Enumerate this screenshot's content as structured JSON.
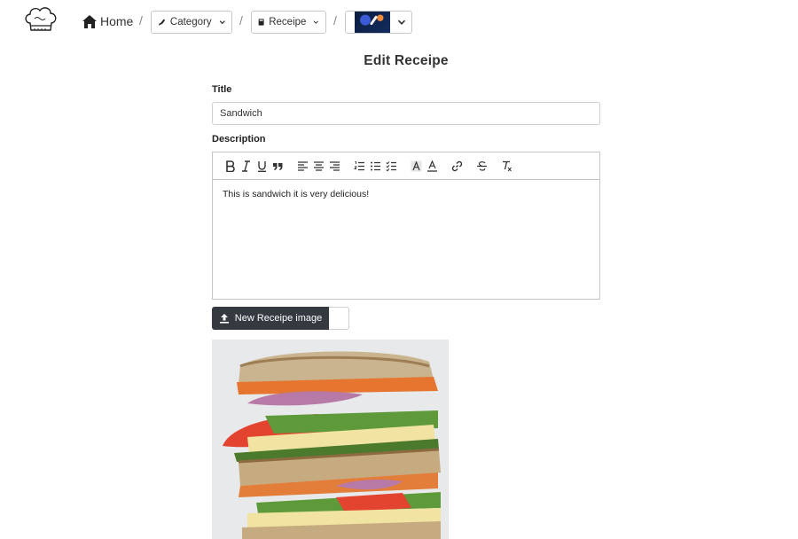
{
  "nav": {
    "home_label": "Home",
    "separator": "/",
    "category_label": "Category",
    "receipe_label": "Receipe"
  },
  "page": {
    "title": "Edit Receipe"
  },
  "form": {
    "title_label": "Title",
    "title_value": "Sandwich",
    "description_label": "Description",
    "description_text": "This is sandwich it is very delicious!",
    "upload_label": "New Receipe image"
  },
  "toolbar_icons": [
    "bold-icon",
    "italic-icon",
    "underline-icon",
    "blockquote-icon",
    "align-left-icon",
    "align-center-icon",
    "align-right-icon",
    "ordered-list-icon",
    "bullet-list-icon",
    "checklist-icon",
    "highlight-icon",
    "font-color-icon",
    "link-icon",
    "strikethrough-icon",
    "clear-format-icon"
  ],
  "colors": {
    "upload_button": "#343a40",
    "border": "#c7c7c7"
  }
}
